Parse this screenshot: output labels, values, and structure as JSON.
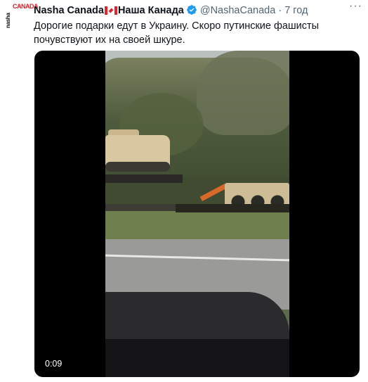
{
  "author": {
    "name_part1": "Nasha Canada",
    "name_part2": "Наша Канада",
    "handle": "@NashaCanada",
    "separator": "·",
    "time": "7 год",
    "avatar_text_top": "nasha",
    "avatar_text_main": "CANADA"
  },
  "tweet": {
    "text": "Дорогие подарки едут в Украину. Скоро путинские фашисты почувствуют их на своей шкуре.",
    "more_label": "···"
  },
  "video": {
    "timestamp": "0:09"
  },
  "icons": {
    "flag": "canada-flag-icon",
    "verified": "verified-badge-icon",
    "more": "more-options-icon"
  },
  "colors": {
    "verified_blue": "#1d9bf0",
    "flag_red": "#e0242b",
    "secondary_text": "#536471"
  }
}
